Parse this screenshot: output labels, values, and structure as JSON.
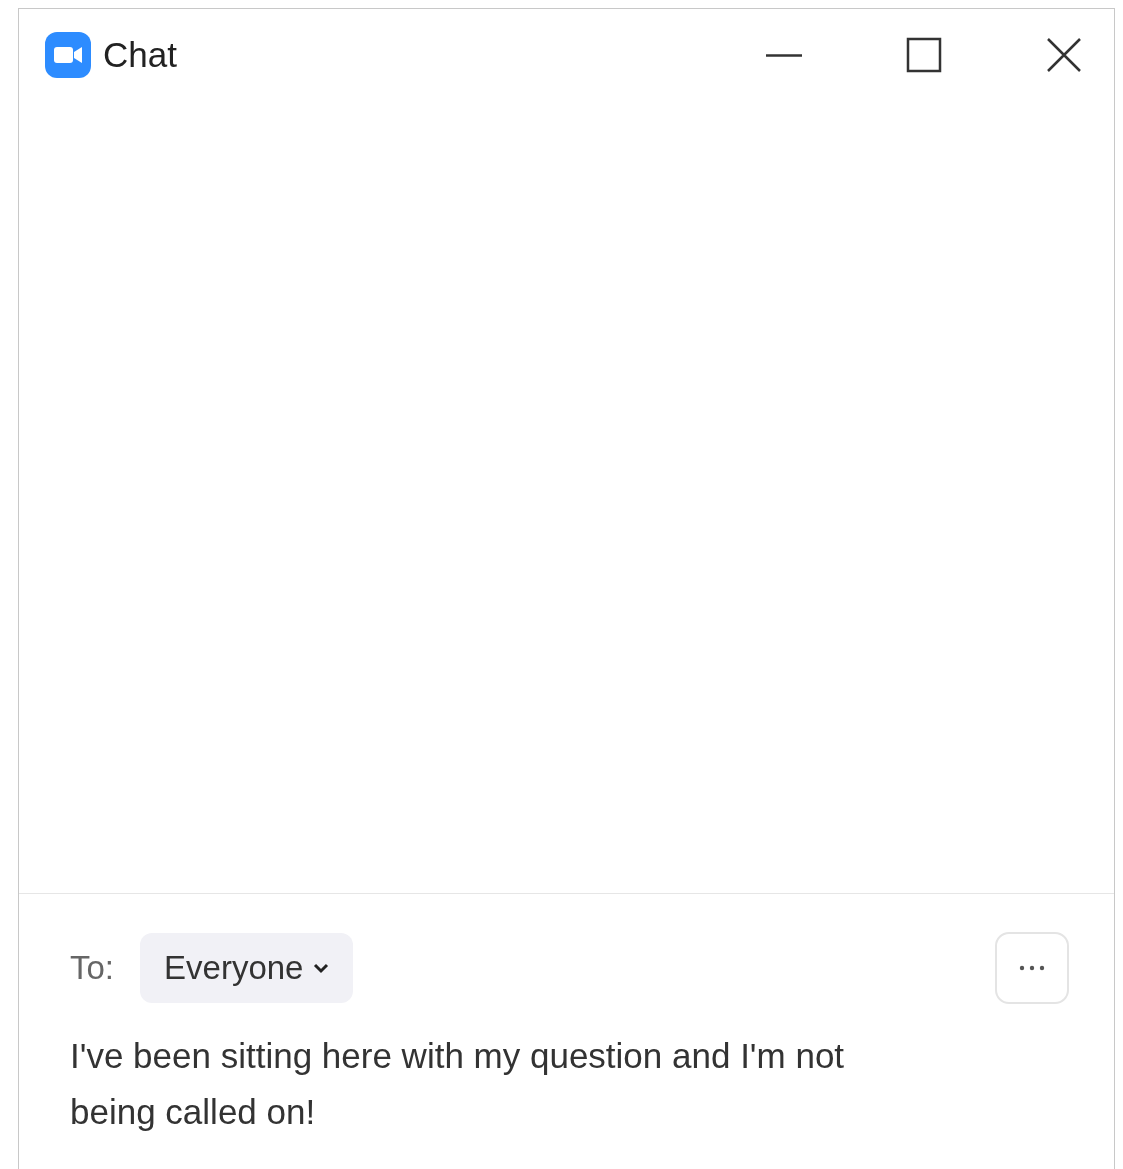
{
  "window": {
    "title": "Chat"
  },
  "composer": {
    "to_label": "To:",
    "recipient": "Everyone",
    "value": "I've been sitting here with my question and I'm not being called on!"
  }
}
